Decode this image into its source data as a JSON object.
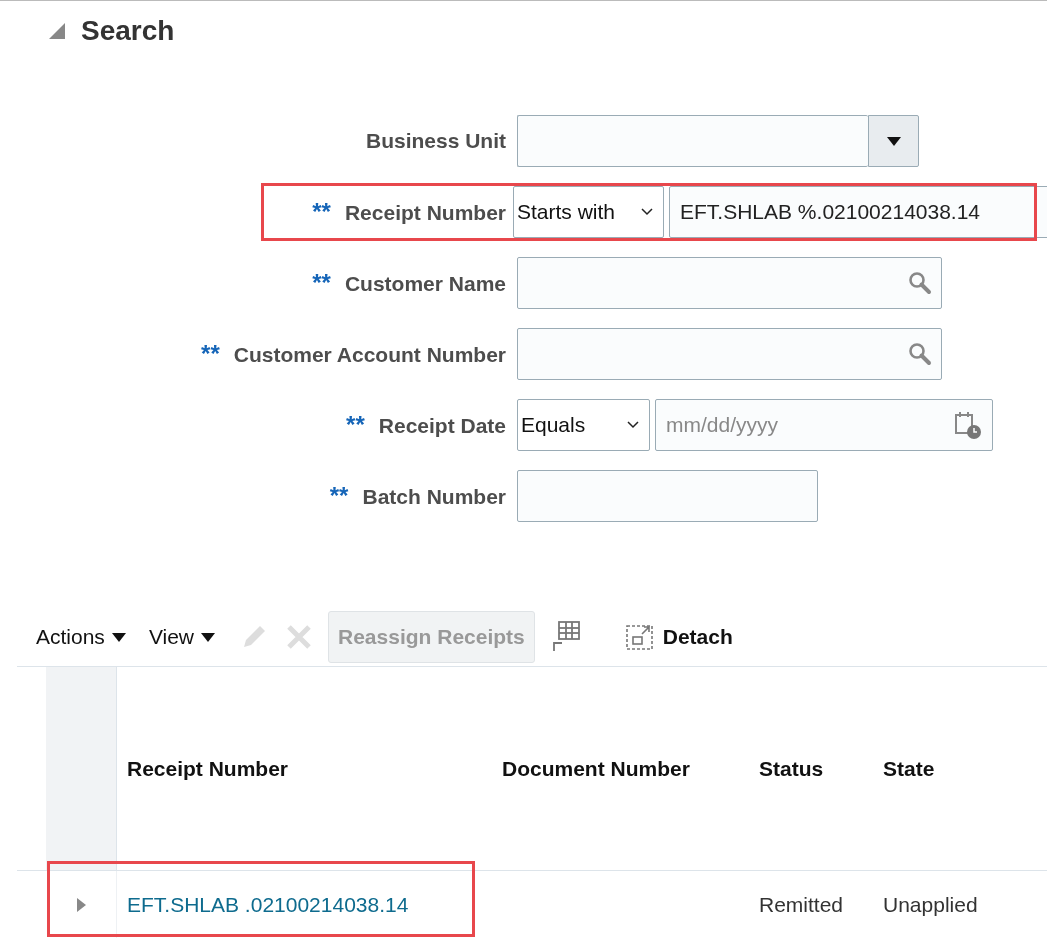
{
  "section": {
    "title": "Search",
    "expanded": true
  },
  "fields": [
    {
      "kind": "choice",
      "label": "Business Unit",
      "highlighted": false
    },
    {
      "kind": "operator_text",
      "label": "Receipt Number",
      "marker": "**",
      "highlighted": true,
      "operator": "Starts with",
      "value": "EFT.SHLAB %.02100214038.14"
    },
    {
      "kind": "lookup",
      "label": "Customer Name",
      "marker": "**",
      "highlighted": false
    },
    {
      "kind": "lookup",
      "label": "Customer Account Number",
      "marker": "**",
      "highlighted": false
    },
    {
      "kind": "operator_date",
      "label": "Receipt Date",
      "marker": "**",
      "highlighted": false,
      "operator": "Equals",
      "placeholder": "mm/dd/yyyy"
    },
    {
      "kind": "text",
      "label": "Batch Number",
      "marker": "**",
      "highlighted": false
    }
  ],
  "toolbar": [
    {
      "kind": "menu",
      "label": "Actions",
      "disabled": false
    },
    {
      "kind": "menu",
      "label": "View",
      "disabled": false
    },
    {
      "kind": "edit",
      "disabled": true
    },
    {
      "kind": "delete",
      "disabled": true
    },
    {
      "kind": "button",
      "label": "Reassign Receipts",
      "disabled": true
    },
    {
      "kind": "export",
      "disabled": false
    },
    {
      "kind": "detach",
      "label": "Detach",
      "disabled": false
    }
  ],
  "table": {
    "columns": [
      "Receipt Number",
      "Document Number",
      "Status",
      "State"
    ],
    "rows": [
      {
        "expanded": false,
        "highlighted": true,
        "cells": [
          "EFT.SHLAB .02100214038.14",
          "",
          "Remitted",
          "Unapplied"
        ]
      }
    ]
  }
}
